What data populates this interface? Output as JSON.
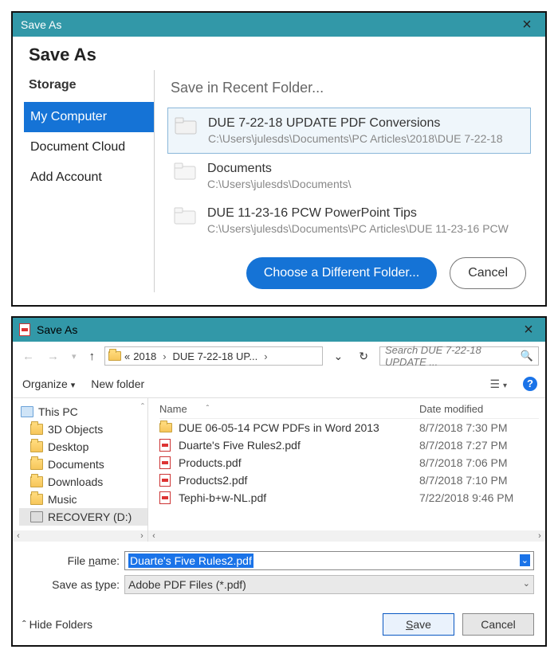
{
  "dialog1": {
    "title": "Save As",
    "heading": "Save As",
    "sidebar": {
      "heading": "Storage",
      "items": [
        "My Computer",
        "Document Cloud",
        "Add Account"
      ],
      "selected": 0
    },
    "content_heading": "Save in Recent Folder...",
    "recent": [
      {
        "name": "DUE 7-22-18 UPDATE PDF Conversions",
        "path": "C:\\Users\\julesds\\Documents\\PC Articles\\2018\\DUE 7-22-18 "
      },
      {
        "name": "Documents",
        "path": "C:\\Users\\julesds\\Documents\\"
      },
      {
        "name": "DUE 11-23-16 PCW PowerPoint Tips",
        "path": "C:\\Users\\julesds\\Documents\\PC Articles\\DUE 11-23-16 PCW"
      }
    ],
    "choose_label": "Choose a Different Folder...",
    "cancel_label": "Cancel"
  },
  "dialog2": {
    "title": "Save As",
    "breadcrumb": {
      "pre": "«",
      "p1": "2018",
      "p2": "DUE 7-22-18 UP...",
      "tail": "›"
    },
    "search_placeholder": "Search DUE 7-22-18 UPDATE ...",
    "toolbar": {
      "organize": "Organize",
      "newfolder": "New folder"
    },
    "tree": [
      {
        "label": "This PC",
        "icon": "pc"
      },
      {
        "label": "3D Objects",
        "icon": "folder"
      },
      {
        "label": "Desktop",
        "icon": "folder"
      },
      {
        "label": "Documents",
        "icon": "folder"
      },
      {
        "label": "Downloads",
        "icon": "folder"
      },
      {
        "label": "Music",
        "icon": "folder"
      },
      {
        "label": "RECOVERY (D:)",
        "icon": "drive"
      }
    ],
    "columns": {
      "name": "Name",
      "date": "Date modified"
    },
    "files": [
      {
        "icon": "folder",
        "name": "DUE 06-05-14 PCW PDFs in Word 2013",
        "date": "8/7/2018 7:30 PM"
      },
      {
        "icon": "pdf",
        "name": "Duarte's Five Rules2.pdf",
        "date": "8/7/2018 7:27 PM"
      },
      {
        "icon": "pdf",
        "name": "Products.pdf",
        "date": "8/7/2018 7:06 PM"
      },
      {
        "icon": "pdf",
        "name": "Products2.pdf",
        "date": "8/7/2018 7:10 PM"
      },
      {
        "icon": "pdf",
        "name": "Tephi-b+w-NL.pdf",
        "date": "7/22/2018 9:46 PM"
      }
    ],
    "filename_label": "File name:",
    "filename_value": "Duarte's Five Rules2.pdf",
    "type_label": "Save as type:",
    "type_value": "Adobe PDF Files (*.pdf)",
    "hide_folders": "Hide Folders",
    "save_label": "Save",
    "cancel_label": "Cancel"
  }
}
